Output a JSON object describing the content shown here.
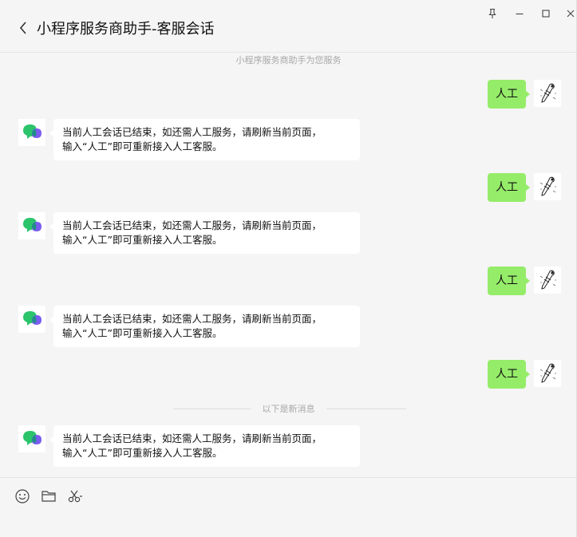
{
  "header": {
    "title": "小程序服务商助手-客服会话"
  },
  "chat": {
    "service_note": "小程序服务商助手为您服务",
    "new_messages_divider": "以下是新消息",
    "messages": [
      {
        "from": "user",
        "text": "人工"
      },
      {
        "from": "bot",
        "line1": "当前人工会话已结束，如还需人工服务，请刷新当前页面，",
        "line2": "输入“人工”即可重新接入人工客服。"
      },
      {
        "from": "user",
        "text": "人工"
      },
      {
        "from": "bot",
        "line1": "当前人工会话已结束，如还需人工服务，请刷新当前页面，",
        "line2": "输入“人工”即可重新接入人工客服。"
      },
      {
        "from": "user",
        "text": "人工"
      },
      {
        "from": "bot",
        "line1": "当前人工会话已结束，如还需人工服务，请刷新当前页面，",
        "line2": "输入“人工”即可重新接入人工客服。"
      },
      {
        "from": "user",
        "text": "人工"
      },
      {
        "from": "bot",
        "line1": "当前人工会话已结束，如还需人工服务，请刷新当前页面，",
        "line2": "输入“人工”即可重新接入人工客服。"
      }
    ]
  },
  "toolbar": {
    "icons": [
      "emoji-icon",
      "folder-icon",
      "scissors-icon"
    ]
  },
  "colors": {
    "user_bubble": "#95ec69",
    "bot_bubble": "#ffffff",
    "background": "#f5f5f5",
    "bot_logo_green": "#2bc46b",
    "bot_logo_purple": "#7b5cf0"
  }
}
